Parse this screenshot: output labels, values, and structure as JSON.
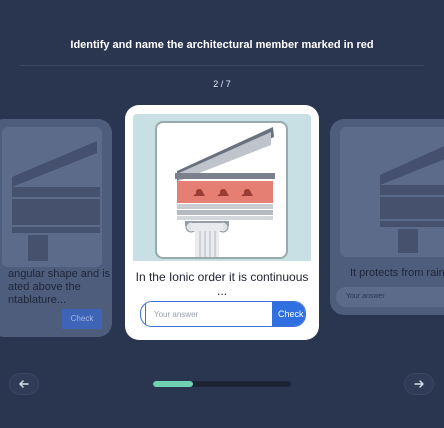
{
  "header": {
    "title": "Identify and name the architectural member marked in red",
    "counter": "2 / 7"
  },
  "cards": {
    "previous": {
      "text_lines": [
        "angular shape and is",
        "ated above the",
        "ntablature..."
      ],
      "check_label": "Check"
    },
    "current": {
      "question": "In the Ionic order it is continuous ...",
      "answer_placeholder": "Your answer",
      "answer_value": "",
      "check_label": "Check",
      "highlight_color": "#e57f73"
    },
    "next": {
      "text": "It protects from rain",
      "answer_placeholder": "Your answer"
    }
  },
  "navigation": {
    "prev_icon": "arrow-left-icon",
    "next_icon": "arrow-right-icon"
  },
  "progress": {
    "current": 2,
    "total": 7,
    "fraction": 0.29
  },
  "colors": {
    "background": "#2a3550",
    "accent": "#2f6fe0",
    "progress": "#6fd3b3"
  }
}
